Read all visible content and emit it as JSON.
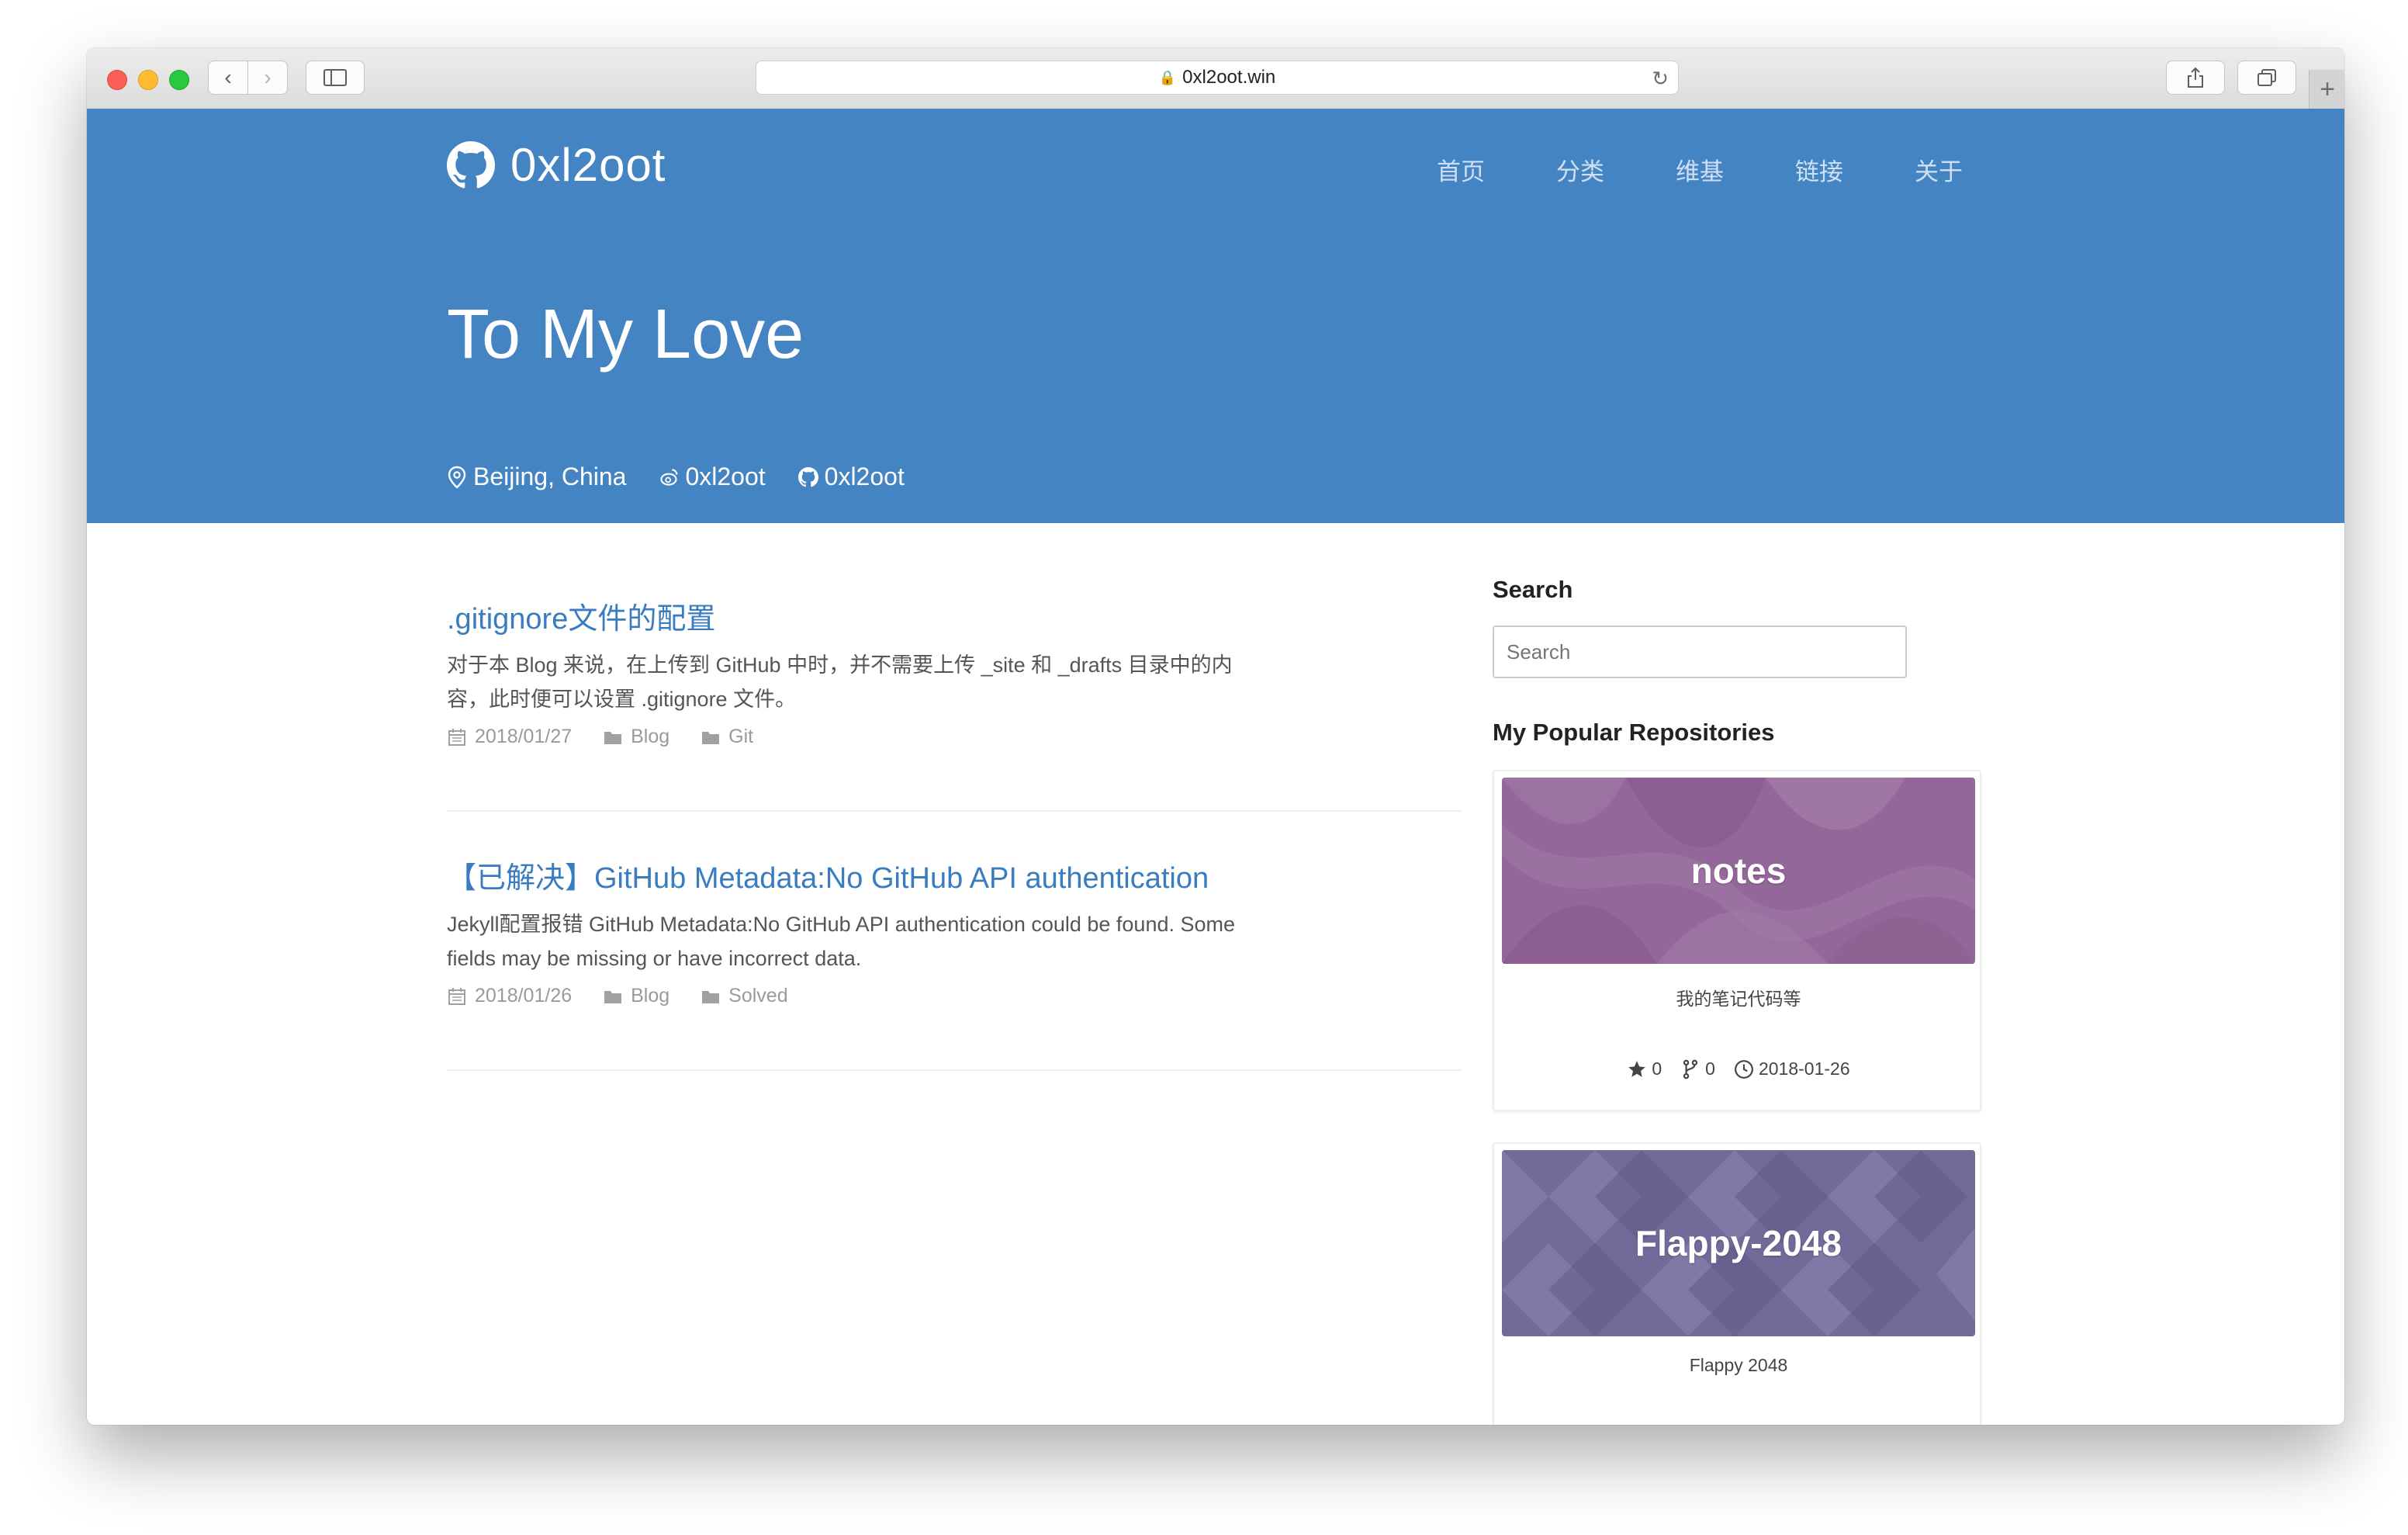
{
  "browser": {
    "url": "0xl2oot.win"
  },
  "site": {
    "brand": "0xl2oot",
    "nav": [
      "首页",
      "分类",
      "维基",
      "链接",
      "关于"
    ],
    "hero_title": "To My Love",
    "meta": {
      "location": "Beijing, China",
      "weibo": "0xl2oot",
      "github": "0xl2oot"
    }
  },
  "posts": [
    {
      "title": ".gitignore文件的配置",
      "excerpt_lines": [
        "对于本 Blog 来说，在上传到 GitHub 中时，并不需要上传 _site 和 _drafts 目录中的内",
        "容，此时便可以设置 .gitignore 文件。"
      ],
      "date": "2018/01/27",
      "category": "Blog",
      "tag": "Git"
    },
    {
      "title": "【已解决】GitHub Metadata:No GitHub API authentication",
      "excerpt_lines": [
        "Jekyll配置报错 GitHub Metadata:No GitHub API authentication could be found. Some",
        "fields may be missing or have incorrect data."
      ],
      "date": "2018/01/26",
      "category": "Blog",
      "tag": "Solved"
    }
  ],
  "sidebar": {
    "search_heading": "Search",
    "search_placeholder": "Search",
    "repos_heading": "My Popular Repositories",
    "repos": [
      {
        "name": "notes",
        "description": "我的笔记代码等",
        "stars": "0",
        "forks": "0",
        "updated": "2018-01-26",
        "color": "#94679a"
      },
      {
        "name": "Flappy-2048",
        "description": "Flappy 2048",
        "color": "#716b99"
      }
    ]
  }
}
